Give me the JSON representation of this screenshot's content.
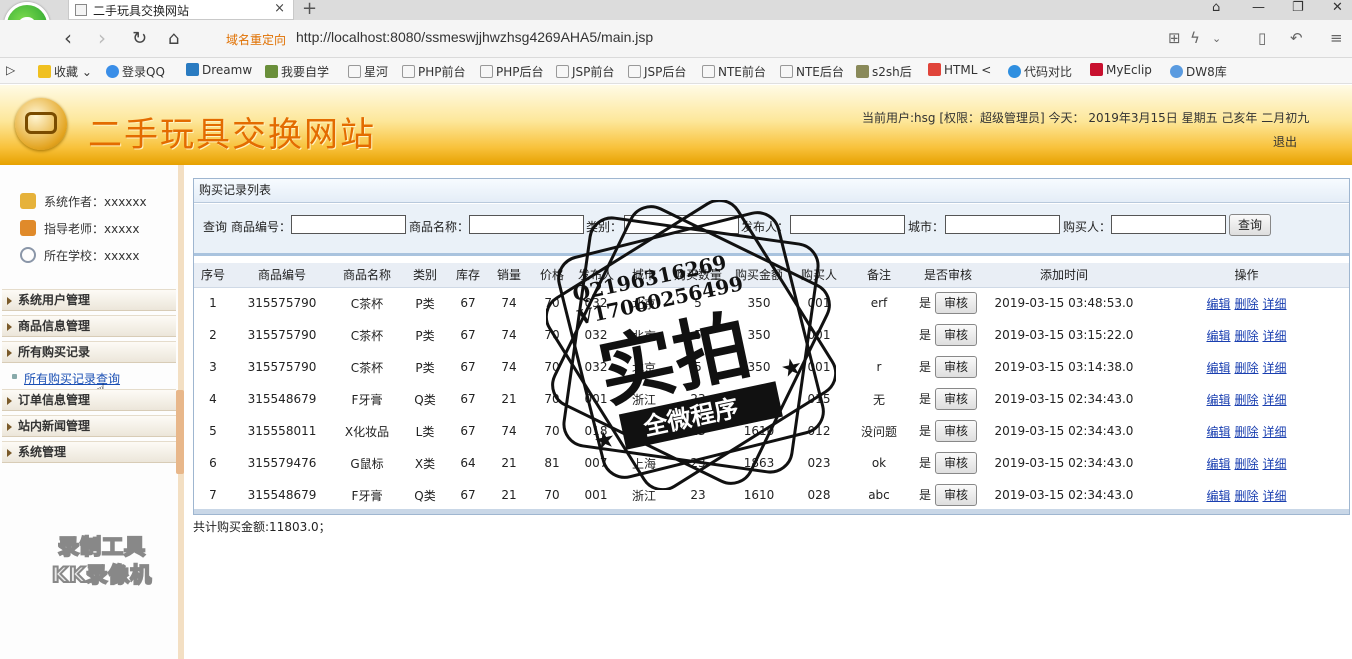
{
  "browser": {
    "tab_title": "二手玩具交换网站",
    "tab_close": "×",
    "new_tab": "+",
    "redirect_label": "域名重定向",
    "url": "http://localhost:8080/ssmeswjjhwzhsg4269AHA5/main.jsp",
    "bookmarks": [
      "收藏",
      "登录QQ",
      "Dreamw",
      "我要自学",
      "星河",
      "PHP前台",
      "PHP后台",
      "JSP前台",
      "JSP后台",
      "NTE前台",
      "NTE后台",
      "s2sh后",
      "HTML",
      "代码对比",
      "MyEclip",
      "DW8库"
    ]
  },
  "header": {
    "site_title": "二手玩具交换网站",
    "user_info": "当前用户:hsg [权限：超级管理员] 今天： 2019年3月15日 星期五 己亥年 二月初九",
    "logout": "退出"
  },
  "sidebar": {
    "info": [
      "系统作者：xxxxxx",
      "指导老师：xxxxx",
      "所在学校：xxxxx"
    ],
    "menus": [
      "系统用户管理",
      "商品信息管理",
      "所有购买记录",
      "订单信息管理",
      "站内新闻管理",
      "系统管理"
    ],
    "submenu": "所有购买记录查询",
    "watermark_line1": "录制工具",
    "watermark_line2": "KK录像机"
  },
  "panel": {
    "title": "购买记录列表",
    "search": {
      "prefix": "查询",
      "labels": [
        "商品编号：",
        "商品名称：",
        "类别：",
        "发布人：",
        "城市：",
        "购买人："
      ],
      "values": [
        "",
        "",
        "",
        "",
        "",
        ""
      ],
      "button": "查询"
    },
    "columns": [
      "序号",
      "商品编号",
      "商品名称",
      "类别",
      "库存",
      "销量",
      "价格",
      "发布人",
      "城市",
      "购买数量",
      "购买金额",
      "购买人",
      "备注",
      "是否审核",
      "添加时间",
      "操作"
    ],
    "rows": [
      [
        "1",
        "315575790",
        "C茶杯",
        "P类",
        "67",
        "74",
        "70",
        "032",
        "北京",
        "5",
        "350",
        "001",
        "erf",
        "是",
        "2019-03-15 03:48:53.0"
      ],
      [
        "2",
        "315575790",
        "C茶杯",
        "P类",
        "67",
        "74",
        "70",
        "032",
        "北京",
        "5",
        "350",
        "001",
        "",
        "是",
        "2019-03-15 03:15:22.0"
      ],
      [
        "3",
        "315575790",
        "C茶杯",
        "P类",
        "67",
        "74",
        "70",
        "032",
        "北京",
        "5",
        "350",
        "001",
        "r",
        "是",
        "2019-03-15 03:14:38.0"
      ],
      [
        "4",
        "315548679",
        "F牙膏",
        "Q类",
        "67",
        "21",
        "70",
        "001",
        "浙江",
        "23",
        "5610",
        "015",
        "无",
        "是",
        "2019-03-15 02:34:43.0"
      ],
      [
        "5",
        "315558011",
        "X化妆品",
        "L类",
        "67",
        "74",
        "70",
        "018",
        "北京",
        "23",
        "1610",
        "012",
        "没问题",
        "是",
        "2019-03-15 02:34:43.0"
      ],
      [
        "6",
        "315579476",
        "G鼠标",
        "X类",
        "64",
        "21",
        "81",
        "007",
        "上海",
        "23",
        "1863",
        "023",
        "ok",
        "是",
        "2019-03-15 02:34:43.0"
      ],
      [
        "7",
        "315548679",
        "F牙膏",
        "Q类",
        "67",
        "21",
        "70",
        "001",
        "浙江",
        "23",
        "1610",
        "028",
        "abc",
        "是",
        "2019-03-15 02:34:43.0"
      ]
    ],
    "audit_button": "审核",
    "actions": [
      "编辑",
      "删除",
      "详细"
    ],
    "total": "共计购买金额:11803.0；"
  },
  "stamp": {
    "line1": "Q2196316269",
    "line2": "V17060256499",
    "main": "实拍",
    "banner": "全微程序"
  }
}
